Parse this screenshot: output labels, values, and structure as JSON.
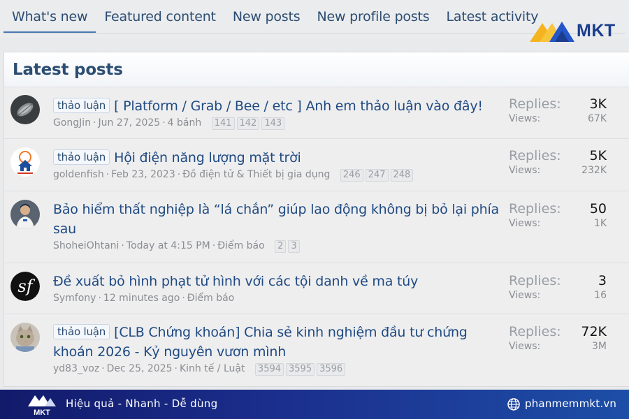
{
  "tabs": [
    "What's new",
    "Featured content",
    "New posts",
    "New profile posts",
    "Latest activity"
  ],
  "brand": {
    "logo_text": "MKT",
    "accent": "#1a3d8f",
    "logo_yellow": "#f5b41f"
  },
  "panel": {
    "title": "Latest posts"
  },
  "stats_labels": {
    "replies": "Replies:",
    "views": "Views:"
  },
  "threads": [
    {
      "prefix": "thảo luận",
      "title": "[ Platform / Grab / Bee / etc ] Anh em thảo luận vào đây!",
      "author": "GongJin",
      "date": "Jun 27, 2025",
      "forum": "4 bánh",
      "pages": [
        "141",
        "142",
        "143"
      ],
      "replies": "3K",
      "views": "67K",
      "avatar": "leaf-avatar"
    },
    {
      "prefix": "thảo luận",
      "title": "Hội điện năng lượng mặt trời",
      "author": "goldenfish",
      "date": "Feb 23, 2023",
      "forum": "Đồ điện tử & Thiết bị gia dụng",
      "pages": [
        "246",
        "247",
        "248"
      ],
      "replies": "5K",
      "views": "232K",
      "avatar": "solar-house-avatar"
    },
    {
      "prefix": "",
      "title": "Bảo hiểm thất nghiệp là “lá chắn” giúp lao động không bị bỏ lại phía sau",
      "author": "ShoheiOhtani",
      "date": "Today at 4:15 PM",
      "forum": "Điểm báo",
      "pages": [
        "2",
        "3"
      ],
      "replies": "50",
      "views": "1K",
      "avatar": "baseball-player-avatar"
    },
    {
      "prefix": "",
      "title": "Đề xuất bỏ hình phạt tử hình với các tội danh về ma túy",
      "author": "Symfony",
      "date": "12 minutes ago",
      "forum": "Điểm báo",
      "pages": [],
      "replies": "3",
      "views": "16",
      "avatar": "symfony-logo-avatar"
    },
    {
      "prefix": "thảo luận",
      "title": "[CLB Chứng khoán] Chia sẻ kinh nghiệm đầu tư chứng khoán 2026 - Kỷ nguyên vươn mình",
      "author": "yd83_voz",
      "date": "Dec 25, 2025",
      "forum": "Kinh tế / Luật",
      "pages": [
        "3594",
        "3595",
        "3596"
      ],
      "replies": "72K",
      "views": "3M",
      "avatar": "cat-avatar"
    }
  ],
  "footer": {
    "logo_text": "MKT",
    "slogan": "Hiệu quả - Nhanh - Dễ dùng",
    "website": "phanmemmkt.vn"
  }
}
